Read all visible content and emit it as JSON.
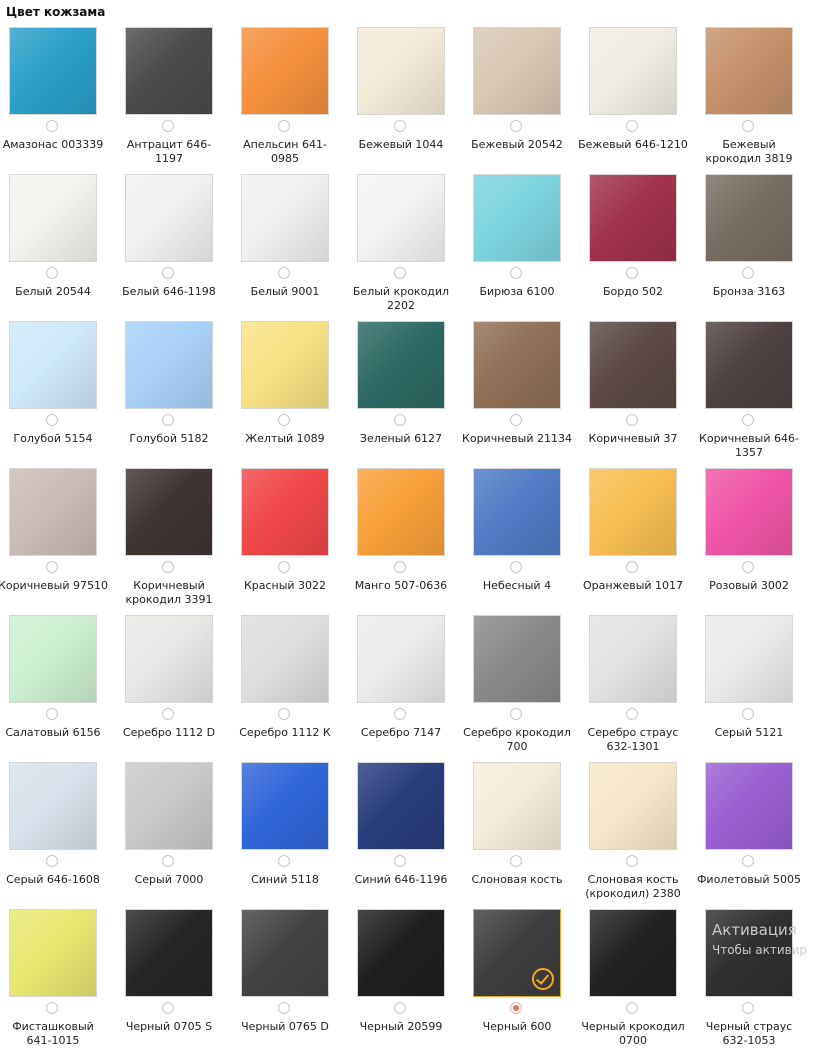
{
  "heading": "Цвет кожзама",
  "swatches": [
    {
      "label": "Амазонас 003339",
      "color": "#2aa0c9"
    },
    {
      "label": "Антрацит 646-1197",
      "color": "#4b4b4d"
    },
    {
      "label": "Апельсин 641-0985",
      "color": "#f5903e"
    },
    {
      "label": "Бежевый 1044",
      "color": "#f3ebda"
    },
    {
      "label": "Бежевый 20542",
      "color": "#d8c8b4"
    },
    {
      "label": "Бежевый 646-1210",
      "color": "#f1ede4"
    },
    {
      "label": "Бежевый крокодил 3819",
      "color": "#c4926a"
    },
    {
      "label": "Белый 20544",
      "color": "#f4f3ef"
    },
    {
      "label": "Белый 646-1198",
      "color": "#f1f1ef"
    },
    {
      "label": "Белый 9001",
      "color": "#f0f0f0"
    },
    {
      "label": "Белый крокодил 2202",
      "color": "#f4f4f4"
    },
    {
      "label": "Бирюза 6100",
      "color": "#7dd4de"
    },
    {
      "label": "Бордо 502",
      "color": "#a0324c"
    },
    {
      "label": "Бронза 3163",
      "color": "#786d62"
    },
    {
      "label": "Голубой 5154",
      "color": "#cfe8fa"
    },
    {
      "label": "Голубой 5182",
      "color": "#a9d1f7"
    },
    {
      "label": "Желтый 1089",
      "color": "#f7e384"
    },
    {
      "label": "Зеленый 6127",
      "color": "#2c6a63"
    },
    {
      "label": "Коричневый 21134",
      "color": "#8f7057"
    },
    {
      "label": "Коричневый 37",
      "color": "#5b4a45"
    },
    {
      "label": "Коричневый 646-1357",
      "color": "#4e4241"
    },
    {
      "label": "Коричневый 97510",
      "color": "#cbbcb5"
    },
    {
      "label": "Коричневый крокодил 3391",
      "color": "#3f3432"
    },
    {
      "label": "Красный 3022",
      "color": "#f04848"
    },
    {
      "label": "Манго 507-0636",
      "color": "#f8a03a"
    },
    {
      "label": "Небесный 4",
      "color": "#4f7cc6"
    },
    {
      "label": "Оранжевый 1017",
      "color": "#f8be52"
    },
    {
      "label": "Розовый 3002",
      "color": "#ef56a6"
    },
    {
      "label": "Салатовый 6156",
      "color": "#cdefd1"
    },
    {
      "label": "Серебро 1112 D",
      "color": "#e8e8e6"
    },
    {
      "label": "Серебро 1112 К",
      "color": "#dedede"
    },
    {
      "label": "Серебро 7147",
      "color": "#ececec"
    },
    {
      "label": "Серебро крокодил 700",
      "color": "#8a8a8a"
    },
    {
      "label": "Серебро страус 632-1301",
      "color": "#e3e3e3"
    },
    {
      "label": "Серый 5121",
      "color": "#ebebeb"
    },
    {
      "label": "Серый 646-1608",
      "color": "#d8e2ec"
    },
    {
      "label": "Серый 7000",
      "color": "#c9c9cb"
    },
    {
      "label": "Синий 5118",
      "color": "#2f66d8"
    },
    {
      "label": "Синий 646-1196",
      "color": "#2a3c7c"
    },
    {
      "label": "Слоновая кость",
      "color": "#f6ecda"
    },
    {
      "label": "Слоновая кость (крокодил) 2380",
      "color": "#f6e8c7"
    },
    {
      "label": "Фиолетовый 5005",
      "color": "#9a5fd3"
    },
    {
      "label": "Фисташковый 641-1015",
      "color": "#e8e872"
    },
    {
      "label": "Черный 0705 S",
      "color": "#262626"
    },
    {
      "label": "Черный 0765 D",
      "color": "#434343"
    },
    {
      "label": "Черный 20599",
      "color": "#1f1f1f"
    },
    {
      "label": "Черный 600",
      "color": "#3e3e3e",
      "selected": true
    },
    {
      "label": "Черный крокодил 0700",
      "color": "#222222"
    },
    {
      "label": "Черный страус 632-1053",
      "color": "#303030"
    }
  ],
  "watermark": {
    "line1": "Активация",
    "line2": "Чтобы активир"
  }
}
